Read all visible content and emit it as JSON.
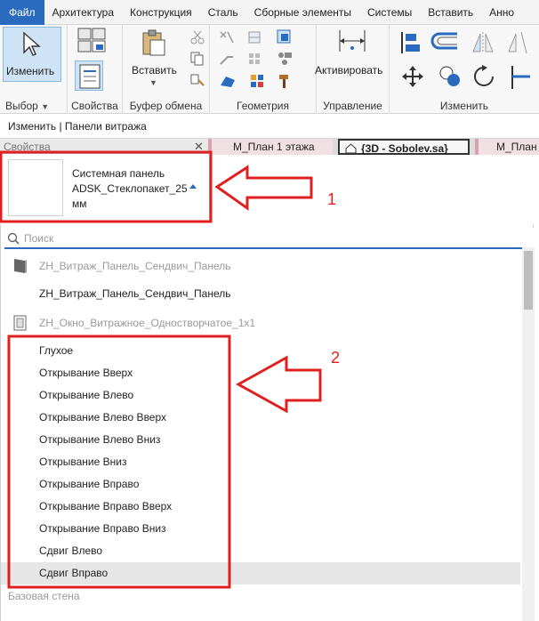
{
  "ribbon_tabs": [
    "Файл",
    "Архитектура",
    "Конструкция",
    "Сталь",
    "Сборные элементы",
    "Системы",
    "Вставить",
    "Анно"
  ],
  "groups": {
    "select": {
      "button": "Изменить",
      "label": "Выбор"
    },
    "properties": {
      "label": "Свойства"
    },
    "clipboard": {
      "button": "Вставить",
      "label": "Буфер обмена"
    },
    "geometry": {
      "label": "Геометрия"
    },
    "manage": {
      "button": "Активировать",
      "label": "Управление"
    },
    "modify": {
      "label": "Изменить"
    }
  },
  "context_bar": "Изменить | Панели витража",
  "properties_panel": {
    "title": "Свойства",
    "close": "✕"
  },
  "view_tabs": [
    "М_План 1 этажа",
    "{3D - Sobolev.sa}",
    "М_План"
  ],
  "type_selector": {
    "family": "Системная панель",
    "type": "ADSK_Стеклопакет_25 мм"
  },
  "search": {
    "placeholder": "Поиск"
  },
  "families": [
    {
      "name": "ZH_Витраж_Панель_Сендвич_Панель",
      "types": [
        "ZH_Витраж_Панель_Сендвич_Панель"
      ]
    },
    {
      "name": "ZH_Окно_Витражное_Одностворчатое_1x1",
      "types": [
        "Глухое",
        "Открывание Вверх",
        "Открывание Влево",
        "Открывание Влево Вверх",
        "Открывание Влево Вниз",
        "Открывание Вниз",
        "Открывание Вправо",
        "Открывание Вправо Вверх",
        "Открывание Вправо Вниз",
        "Сдвиг Влево",
        "Сдвиг Вправо"
      ]
    }
  ],
  "selected_type": "Сдвиг Вправо",
  "footer_section": "Базовая стена",
  "annotations": {
    "one": "1",
    "two": "2",
    "color": "#e02020"
  }
}
